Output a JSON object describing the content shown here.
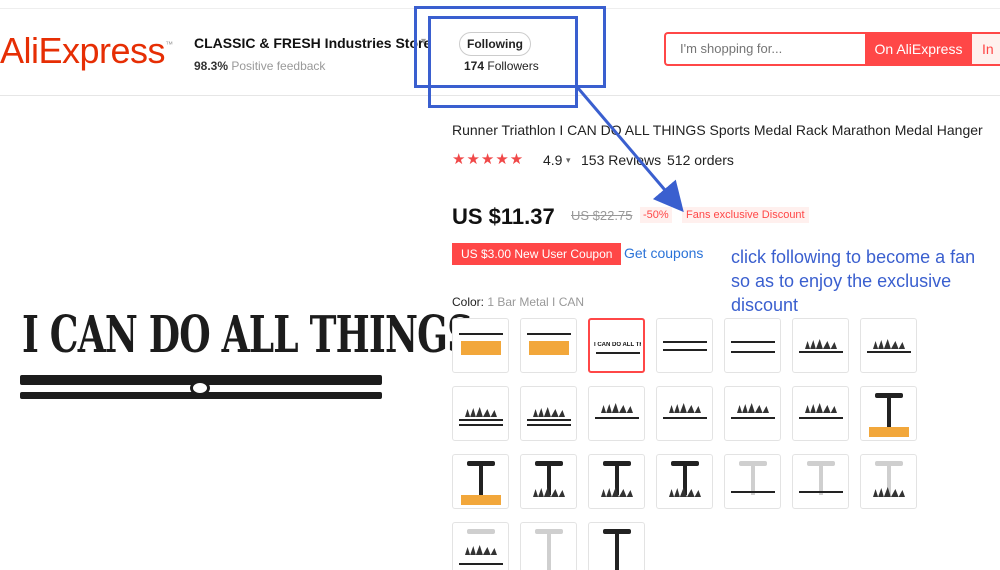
{
  "header": {
    "logo": "AliExpress",
    "store_name": "CLASSIC & FRESH Industries Store",
    "feedback_pct": "98.3%",
    "feedback_text": "Positive feedback",
    "follow_label": "Following",
    "followers_count": "174",
    "followers_label": "Followers",
    "search_placeholder": "I'm shopping for...",
    "search_button": "On AliExpress",
    "search_in": "In"
  },
  "product": {
    "image_text": "I CAN DO ALL THINGS",
    "title": "Runner Triathlon I CAN DO ALL THINGS Sports Medal Rack Marathon Medal Hanger",
    "stars": "★★★★★",
    "rating": "4.9",
    "reviews": "153 Reviews",
    "orders": "512 orders",
    "price": "US $11.37",
    "old_price": "US $22.75",
    "discount": "-50%",
    "fans_badge": "Fans exclusive Discount",
    "coupon": "US $3.00 New User Coupon",
    "get_coupons": "Get coupons",
    "color_label": "Color:",
    "color_value": "1 Bar Metal I CAN",
    "selected_swatch_text": "I CAN DO ALL THINGS"
  },
  "annotation": {
    "text": "click following to become a fan so as to enjoy the exclusive discount"
  },
  "colors": {
    "accent": "#ff4747",
    "logo": "#e62e04",
    "annotation": "#3a5fcf",
    "link": "#2b73d8"
  }
}
